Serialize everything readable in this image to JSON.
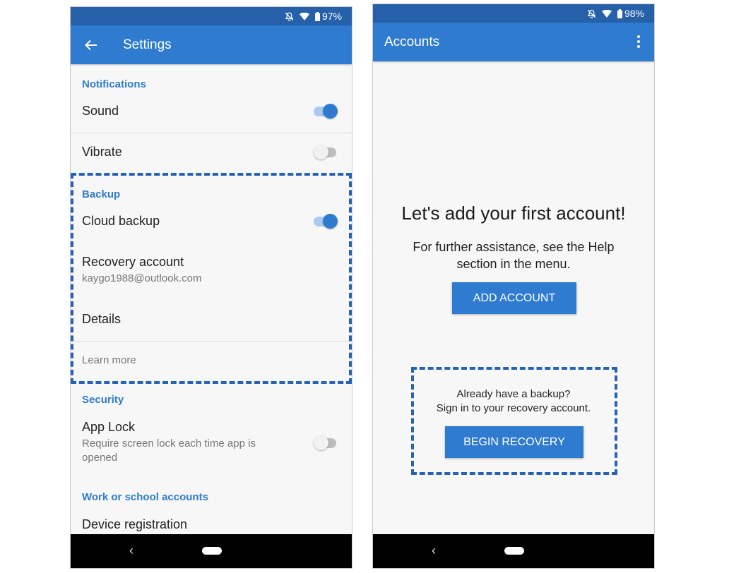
{
  "settings_screen": {
    "status_bar": {
      "battery": "97%",
      "icons": [
        "bell-off-icon",
        "wifi-icon",
        "battery-icon"
      ]
    },
    "app_bar": {
      "title": "Settings",
      "back_icon": "arrow-left-icon"
    },
    "sections": {
      "notifications": {
        "header": "Notifications",
        "sound": {
          "label": "Sound",
          "enabled": true
        },
        "vibrate": {
          "label": "Vibrate",
          "enabled": false
        }
      },
      "backup": {
        "header": "Backup",
        "cloud_backup": {
          "label": "Cloud backup",
          "enabled": true
        },
        "recovery_account": {
          "label": "Recovery account",
          "value": "kaygo1988@outlook.com"
        },
        "details": {
          "label": "Details"
        },
        "learn_more": {
          "label": "Learn more"
        }
      },
      "security": {
        "header": "Security",
        "app_lock": {
          "label": "App Lock",
          "description": "Require screen lock each time app is opened",
          "enabled": false
        }
      },
      "work_school": {
        "header": "Work or school accounts",
        "device_registration": {
          "label": "Device registration"
        }
      }
    },
    "nav_bar": {
      "back": "‹"
    }
  },
  "accounts_screen": {
    "status_bar": {
      "battery": "98%",
      "icons": [
        "bell-off-icon",
        "wifi-icon",
        "battery-icon"
      ]
    },
    "app_bar": {
      "title": "Accounts",
      "menu_icon": "more-vertical-icon"
    },
    "welcome": {
      "title": "Let's add your first account!",
      "subtitle": "For further assistance, see the Help section in the menu.",
      "add_account_button": "ADD ACCOUNT"
    },
    "recovery": {
      "line1": "Already have a backup?",
      "line2": "Sign in to your recovery account.",
      "begin_recovery_button": "BEGIN RECOVERY"
    },
    "nav_bar": {
      "back": "‹"
    }
  },
  "colors": {
    "accent": "#2e7bd0",
    "status_bar": "#2560a8",
    "highlight_dash": "#2563b8"
  }
}
